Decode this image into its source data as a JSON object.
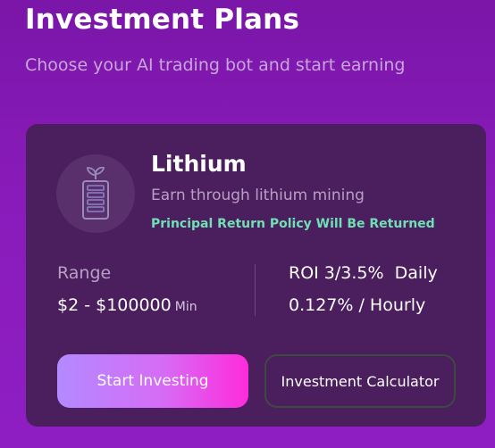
{
  "page": {
    "title": "Investment Plans",
    "subtitle": "Choose your AI trading bot and start earning"
  },
  "plan": {
    "icon": "battery-plant-icon",
    "name": "Lithium",
    "description": "Earn through lithium mining",
    "policy": "Principal Return Policy Will Be Returned",
    "range_label": "Range",
    "range_value": "$2 - $100000",
    "range_suffix": "Min",
    "roi": "ROI 3/3.5%  Daily",
    "hourly": "0.127% / Hourly",
    "start_label": "Start Investing",
    "calculator_label": "Investment Calculator"
  },
  "colors": {
    "background": "#8a1bbb",
    "card": "#4b1e5e",
    "policy_green": "#6fe0b4",
    "button_gradient_start": "#b38aff",
    "button_gradient_end": "#ff2bdb"
  }
}
